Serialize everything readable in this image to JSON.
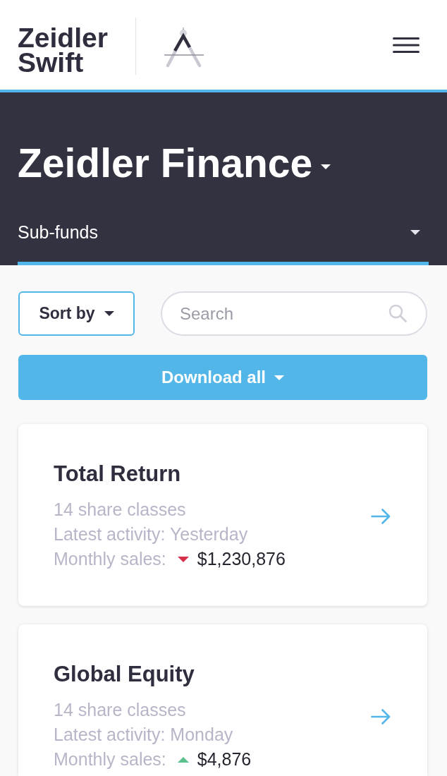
{
  "header": {
    "logo": [
      "Zeidler",
      "Swift"
    ]
  },
  "hero": {
    "title": "Zeidler Finance",
    "dropdown": "Sub-funds"
  },
  "toolbar": {
    "sort_button": "Sort by",
    "search": {
      "placeholder": "Search"
    },
    "download_button": "Download all"
  },
  "funds": [
    {
      "name": "Total Return",
      "share_classes": "14 share classes",
      "latest_activity": "Latest activity: Yesterday",
      "sales_label": "Monthly sales:",
      "rising": false,
      "sales": "$1,230,876"
    },
    {
      "name": "Global Equity",
      "share_classes": "14 share classes",
      "latest_activity": "Latest activity: Monday",
      "sales_label": "Monthly sales:",
      "rising": true,
      "sales": "$4,876"
    }
  ]
}
